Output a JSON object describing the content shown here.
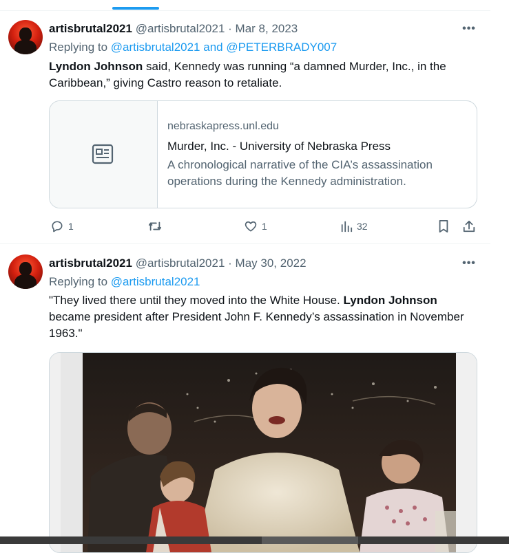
{
  "tweets": [
    {
      "author": "artisbrutal2021",
      "handle": "@artisbrutal2021",
      "separator": "·",
      "date": "Mar 8, 2023",
      "replying_prefix": "Replying to",
      "replying_to": "@artisbrutal2021 and @PETERBRADY007",
      "text_bold": "Lyndon Johnson",
      "text_rest": " said, Kennedy was running “a damned Murder, Inc., in the Caribbean,” giving Castro reason to retaliate.",
      "card": {
        "domain": "nebraskapress.unl.edu",
        "title": "Murder, Inc. - University of Nebraska Press",
        "description": "A chronological narrative of the CIA’s assassination operations during the Kennedy administration."
      },
      "stats": {
        "replies": "1",
        "retweets": "",
        "likes": "1",
        "views": "32"
      }
    },
    {
      "author": "artisbrutal2021",
      "handle": "@artisbrutal2021",
      "separator": "·",
      "date": "May 30, 2022",
      "replying_prefix": "Replying to",
      "replying_to": "@artisbrutal2021",
      "text_before": "\"They lived there until they moved into the White House. ",
      "text_bold": "Lyndon Johnson",
      "text_after": " became president after President John F. Kennedy’s assassination in November 1963.\""
    }
  ],
  "icons": {
    "more": "more-horizontal-icon",
    "reply": "reply-icon",
    "retweet": "retweet-icon",
    "like": "heart-icon",
    "views": "analytics-icon",
    "bookmark": "bookmark-icon",
    "share": "share-icon",
    "card_placeholder": "article-icon"
  },
  "colors": {
    "accent": "#1d9bf0",
    "text_primary": "#0f1419",
    "text_secondary": "#536471",
    "border": "#cfd9de"
  }
}
